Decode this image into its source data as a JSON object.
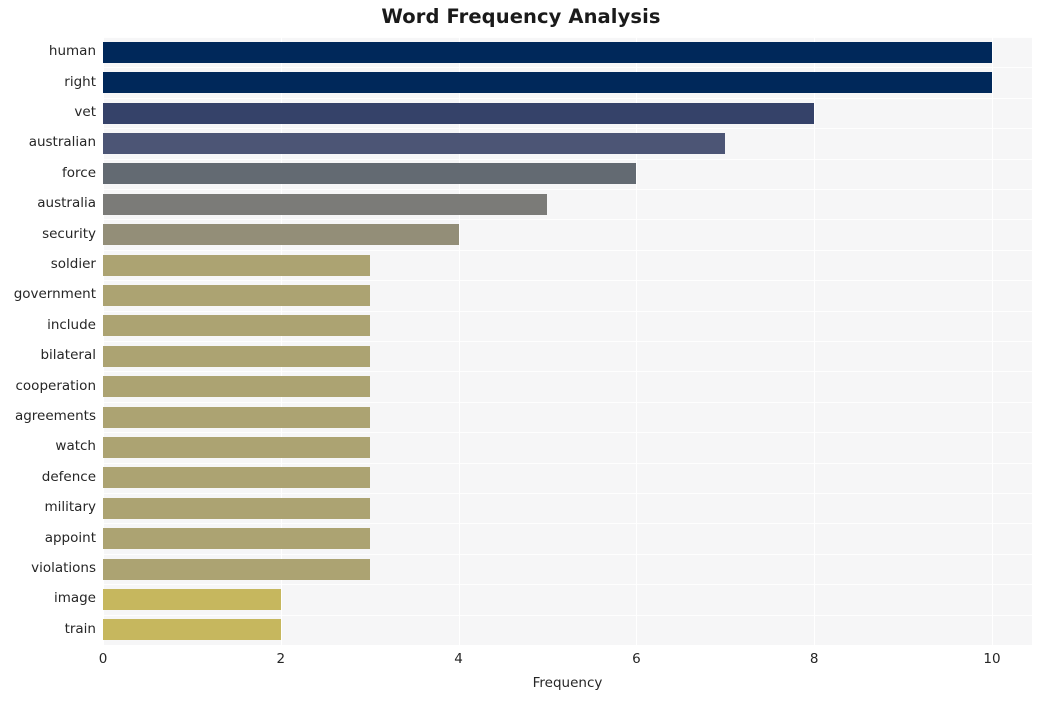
{
  "chart_data": {
    "type": "bar",
    "orientation": "horizontal",
    "title": "Word Frequency Analysis",
    "xlabel": "Frequency",
    "ylabel": "",
    "xlim": [
      0,
      10.45
    ],
    "xticks": [
      0,
      2,
      4,
      6,
      8,
      10
    ],
    "xtick_labels": [
      "0",
      "2",
      "4",
      "6",
      "8",
      "10"
    ],
    "grid": true,
    "grid_axis": "both",
    "legend": null,
    "background": "#f6f6f7",
    "categories": [
      "human",
      "right",
      "vet",
      "australian",
      "force",
      "australia",
      "security",
      "soldier",
      "government",
      "include",
      "bilateral",
      "cooperation",
      "agreements",
      "watch",
      "defence",
      "military",
      "appoint",
      "violations",
      "image",
      "train"
    ],
    "values": [
      10,
      10,
      8,
      7,
      6,
      5,
      4,
      3,
      3,
      3,
      3,
      3,
      3,
      3,
      3,
      3,
      3,
      3,
      2,
      2
    ],
    "bar_colors": [
      "#00285a",
      "#00285a",
      "#354269",
      "#4c5575",
      "#636a72",
      "#7b7b78",
      "#938e78",
      "#aca372",
      "#aca372",
      "#aca372",
      "#aca372",
      "#aca372",
      "#aca372",
      "#aca372",
      "#aca372",
      "#aca372",
      "#aca372",
      "#aca372",
      "#c6b75e",
      "#c6b75e"
    ],
    "colormap": "cividis"
  }
}
